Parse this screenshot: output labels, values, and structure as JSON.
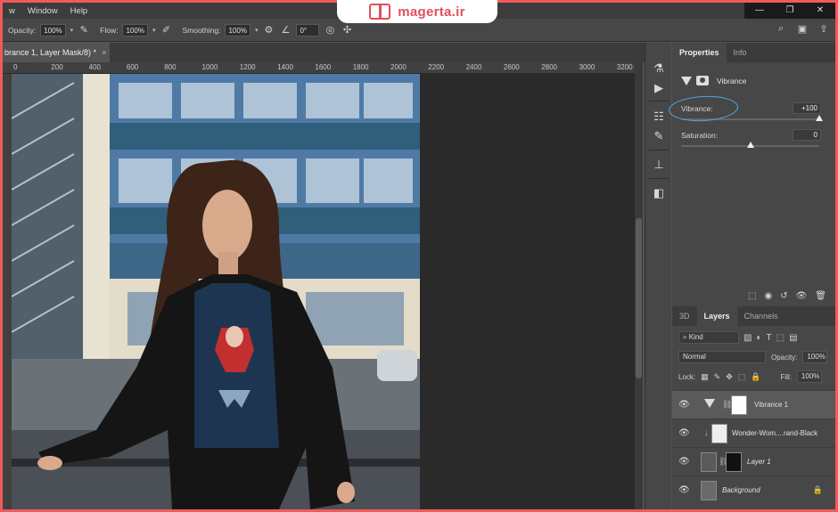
{
  "menu": [
    "w",
    "Window",
    "Help"
  ],
  "window_controls": [
    "—",
    "❐",
    "✕"
  ],
  "watermark": {
    "text": "magerta.ir",
    "color": "#e0505a"
  },
  "options": {
    "opacity_label": "Opacity:",
    "opacity_value": "100%",
    "flow_label": "Flow:",
    "flow_value": "100%",
    "smoothing_label": "Smoothing:",
    "smoothing_value": "100%",
    "angle_value": "0°"
  },
  "document_tab": {
    "title": "brance 1, Layer Mask/8) *",
    "close": "×"
  },
  "ruler": [
    "0",
    "200",
    "400",
    "600",
    "800",
    "1000",
    "1200",
    "1400",
    "1600",
    "1800",
    "2000",
    "2200",
    "2400",
    "2600",
    "2800",
    "3000",
    "3200"
  ],
  "properties": {
    "tabs": [
      "Properties",
      "Info"
    ],
    "adjustment_name": "Vibrance",
    "vibrance_label": "Vibrance:",
    "vibrance_value": "+100",
    "vibrance_level": 1.0,
    "saturation_label": "Saturation:",
    "saturation_value": "0",
    "saturation_level": 0.5
  },
  "layers_panel": {
    "tabs": [
      "3D",
      "Layers",
      "Channels"
    ],
    "kind_label": "Kind",
    "blend_mode": "Normal",
    "opacity_label": "Opacity:",
    "opacity_value": "100%",
    "lock_label": "Lock:",
    "fill_label": "Fill:",
    "fill_value": "100%",
    "layers": [
      {
        "name": "Vibrance 1",
        "active": true
      },
      {
        "name": "Wonder-Wom....rand-Black",
        "active": false
      },
      {
        "name": "Layer 1",
        "active": false
      },
      {
        "name": "Background",
        "active": false
      }
    ]
  },
  "colors": {
    "highlight": "#4aa8e0",
    "panel": "#474747",
    "border": "#f05a5a"
  }
}
